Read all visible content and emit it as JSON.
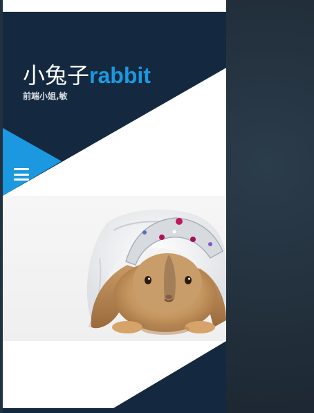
{
  "site": {
    "title_cn": "小兔子",
    "title_en": "rabbit",
    "tagline": "前端小姐,敏"
  },
  "menu": {
    "icon": "hamburger-menu-icon"
  },
  "hero": {
    "image": "rabbit-with-tiara-photo"
  },
  "colors": {
    "navy": "#14293f",
    "accent": "#1b98e0",
    "white": "#ffffff",
    "backdrop": "#1f2b36"
  }
}
